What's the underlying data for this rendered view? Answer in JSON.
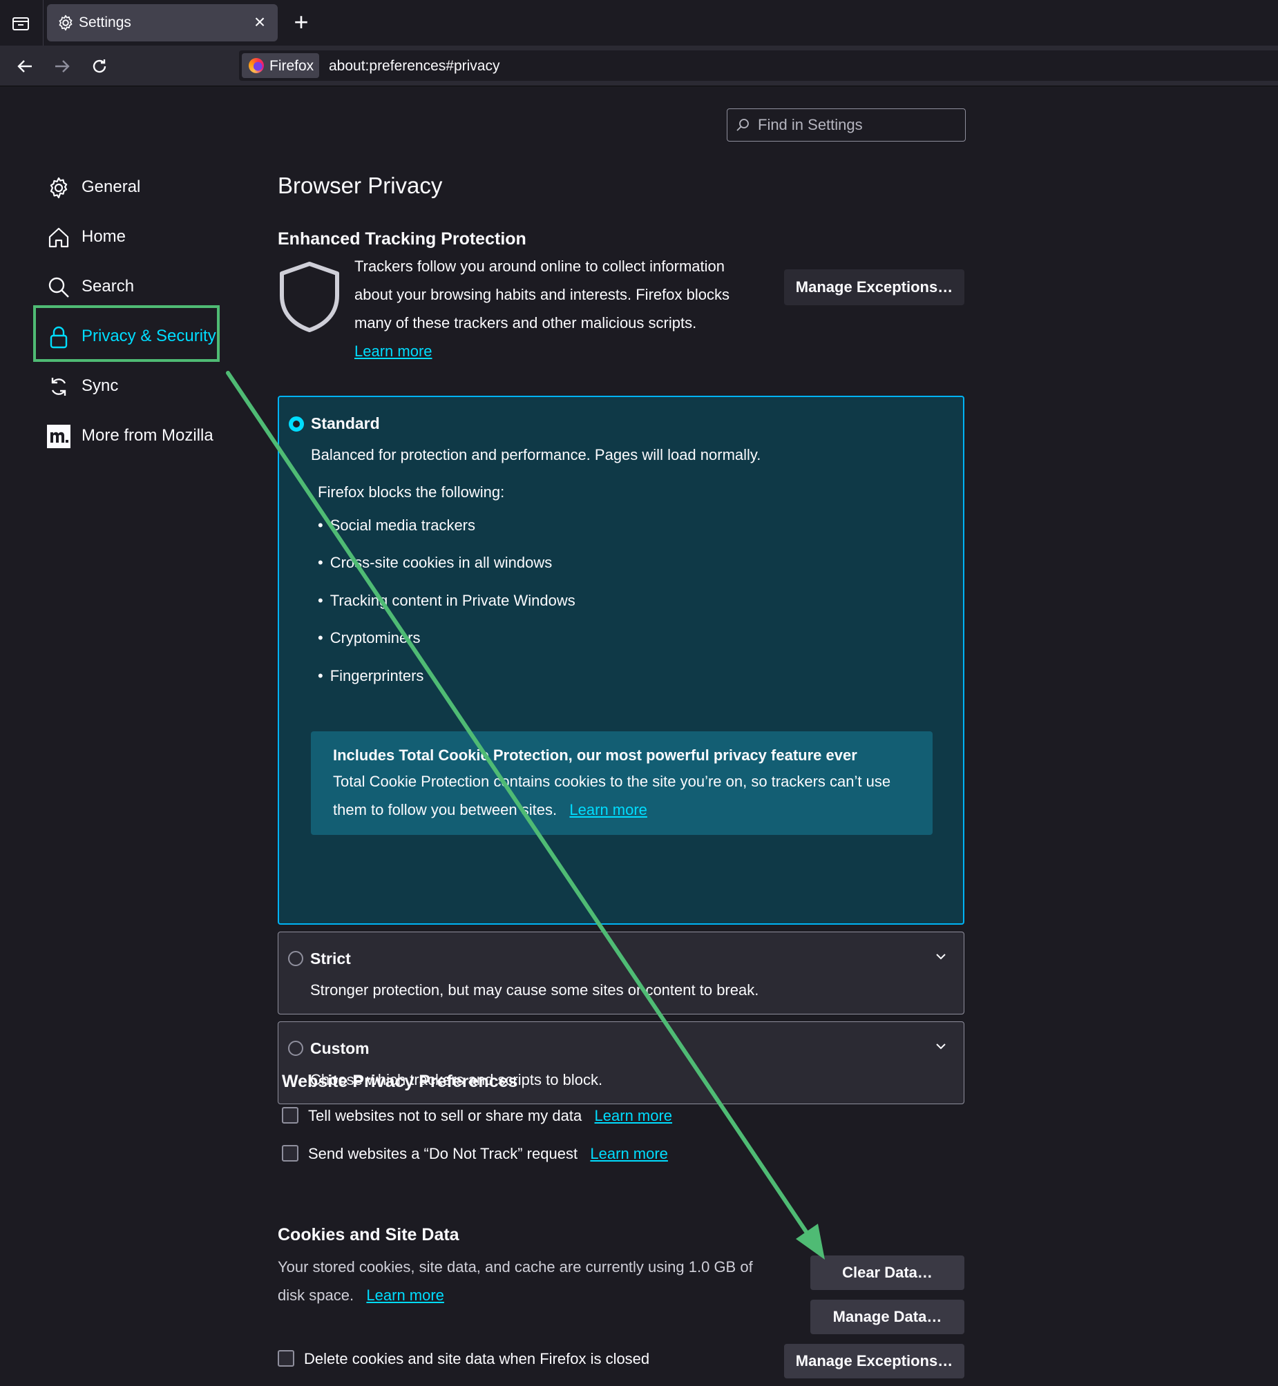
{
  "tab": {
    "title": "Settings",
    "close": "×",
    "new_tab": "+"
  },
  "urlbar": {
    "identity": "Firefox",
    "url": "about:preferences#privacy"
  },
  "search": {
    "placeholder": "Find in Settings"
  },
  "sidebar": {
    "items": [
      {
        "label": "General",
        "icon": "gear-icon"
      },
      {
        "label": "Home",
        "icon": "home-icon"
      },
      {
        "label": "Search",
        "icon": "search-icon"
      },
      {
        "label": "Privacy & Security",
        "icon": "lock-icon",
        "active": true
      },
      {
        "label": "Sync",
        "icon": "sync-icon"
      },
      {
        "label": "More from Mozilla",
        "icon": "mozilla-icon"
      }
    ]
  },
  "main": {
    "title": "Browser Privacy",
    "etp": {
      "heading": "Enhanced Tracking Protection",
      "description": "Trackers follow you around online to collect information about your browsing habits and interests. Firefox blocks many of these trackers and other malicious scripts.",
      "learn_more": "Learn more",
      "manage_exceptions": "Manage Exceptions…"
    },
    "standard": {
      "title": "Standard",
      "description": "Balanced for protection and performance. Pages will load normally.",
      "blocks_heading": "Firefox blocks the following:",
      "blocks": [
        "Social media trackers",
        "Cross-site cookies in all windows",
        "Tracking content in Private Windows",
        "Cryptominers",
        "Fingerprinters"
      ],
      "tcp_title": "Includes Total Cookie Protection, our most powerful privacy feature ever",
      "tcp_text": "Total Cookie Protection contains cookies to the site you’re on, so trackers can’t use them to follow you between sites.",
      "tcp_link": "Learn more"
    },
    "strict": {
      "title": "Strict",
      "description": "Stronger protection, but may cause some sites or content to break."
    },
    "custom": {
      "title": "Custom",
      "description": "Choose which trackers and scripts to block."
    },
    "website_prefs": {
      "heading": "Website Privacy Preferences",
      "items": [
        {
          "label": "Tell websites not to sell or share my data",
          "link": "Learn more",
          "checked": false
        },
        {
          "label": "Send websites a “Do Not Track” request",
          "link": "Learn more",
          "checked": false
        }
      ]
    },
    "cookies": {
      "heading": "Cookies and Site Data",
      "description": "Your stored cookies, site data, and cache are currently using 1.0 GB of disk space.",
      "learn_more": "Learn more",
      "clear_data": "Clear Data…",
      "manage_data": "Manage Data…",
      "manage_exceptions": "Manage Exceptions…",
      "delete_on_close": "Delete cookies and site data when Firefox is closed",
      "delete_on_close_checked": false
    }
  },
  "colors": {
    "accent": "#00ddff",
    "annotation": "#4fbb74",
    "background": "#1c1b22"
  }
}
